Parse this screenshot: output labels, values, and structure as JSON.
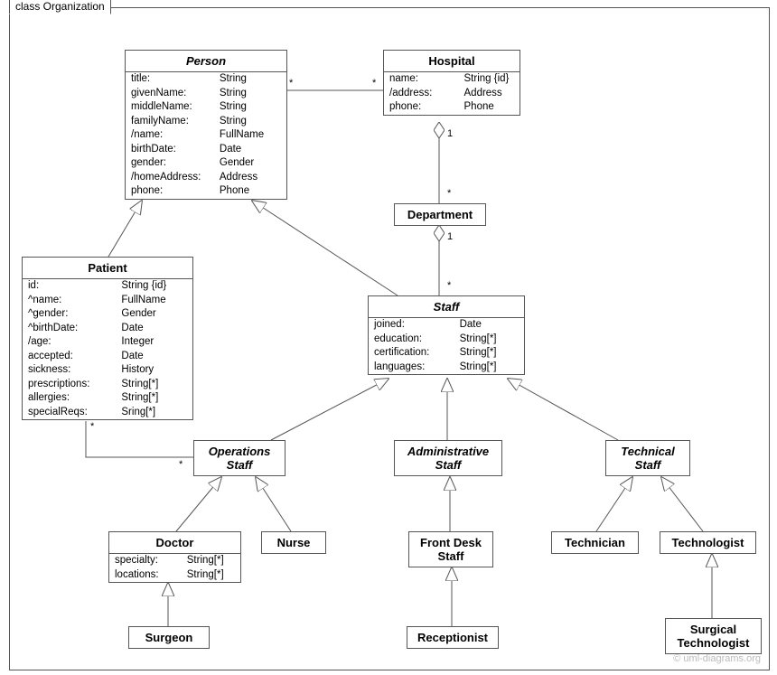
{
  "frame": {
    "label": "class Organization"
  },
  "watermark": "© uml-diagrams.org",
  "classes": {
    "person": {
      "name": "Person",
      "attrs": [
        [
          "title:",
          "String"
        ],
        [
          "givenName:",
          "String"
        ],
        [
          "middleName:",
          "String"
        ],
        [
          "familyName:",
          "String"
        ],
        [
          "/name:",
          "FullName"
        ],
        [
          "birthDate:",
          "Date"
        ],
        [
          "gender:",
          "Gender"
        ],
        [
          "/homeAddress:",
          "Address"
        ],
        [
          "phone:",
          "Phone"
        ]
      ]
    },
    "hospital": {
      "name": "Hospital",
      "attrs": [
        [
          "name:",
          "String {id}"
        ],
        [
          "/address:",
          "Address"
        ],
        [
          "phone:",
          "Phone"
        ]
      ]
    },
    "department": {
      "name": "Department"
    },
    "patient": {
      "name": "Patient",
      "attrs": [
        [
          "id:",
          "String {id}"
        ],
        [
          "^name:",
          "FullName"
        ],
        [
          "^gender:",
          "Gender"
        ],
        [
          "^birthDate:",
          "Date"
        ],
        [
          "/age:",
          "Integer"
        ],
        [
          "accepted:",
          "Date"
        ],
        [
          "sickness:",
          "History"
        ],
        [
          "prescriptions:",
          "String[*]"
        ],
        [
          "allergies:",
          "String[*]"
        ],
        [
          "specialReqs:",
          "Sring[*]"
        ]
      ]
    },
    "staff": {
      "name": "Staff",
      "attrs": [
        [
          "joined:",
          "Date"
        ],
        [
          "education:",
          "String[*]"
        ],
        [
          "certification:",
          "String[*]"
        ],
        [
          "languages:",
          "String[*]"
        ]
      ]
    },
    "operationsStaff": {
      "name": "Operations\nStaff"
    },
    "administrativeStaff": {
      "name": "Administrative\nStaff"
    },
    "technicalStaff": {
      "name": "Technical\nStaff"
    },
    "doctor": {
      "name": "Doctor",
      "attrs": [
        [
          "specialty:",
          "String[*]"
        ],
        [
          "locations:",
          "String[*]"
        ]
      ]
    },
    "nurse": {
      "name": "Nurse"
    },
    "frontDeskStaff": {
      "name": "Front Desk\nStaff"
    },
    "technician": {
      "name": "Technician"
    },
    "technologist": {
      "name": "Technologist"
    },
    "surgeon": {
      "name": "Surgeon"
    },
    "receptionist": {
      "name": "Receptionist"
    },
    "surgicalTechnologist": {
      "name": "Surgical\nTechnologist"
    }
  },
  "multiplicities": {
    "personHospitalLeft": "*",
    "personHospitalRight": "*",
    "hospitalDeptTop": "1",
    "hospitalDeptBottom": "*",
    "deptStaffTop": "1",
    "deptStaffBottom": "*",
    "patientOpsLeft": "*",
    "patientOpsRight": "*"
  }
}
